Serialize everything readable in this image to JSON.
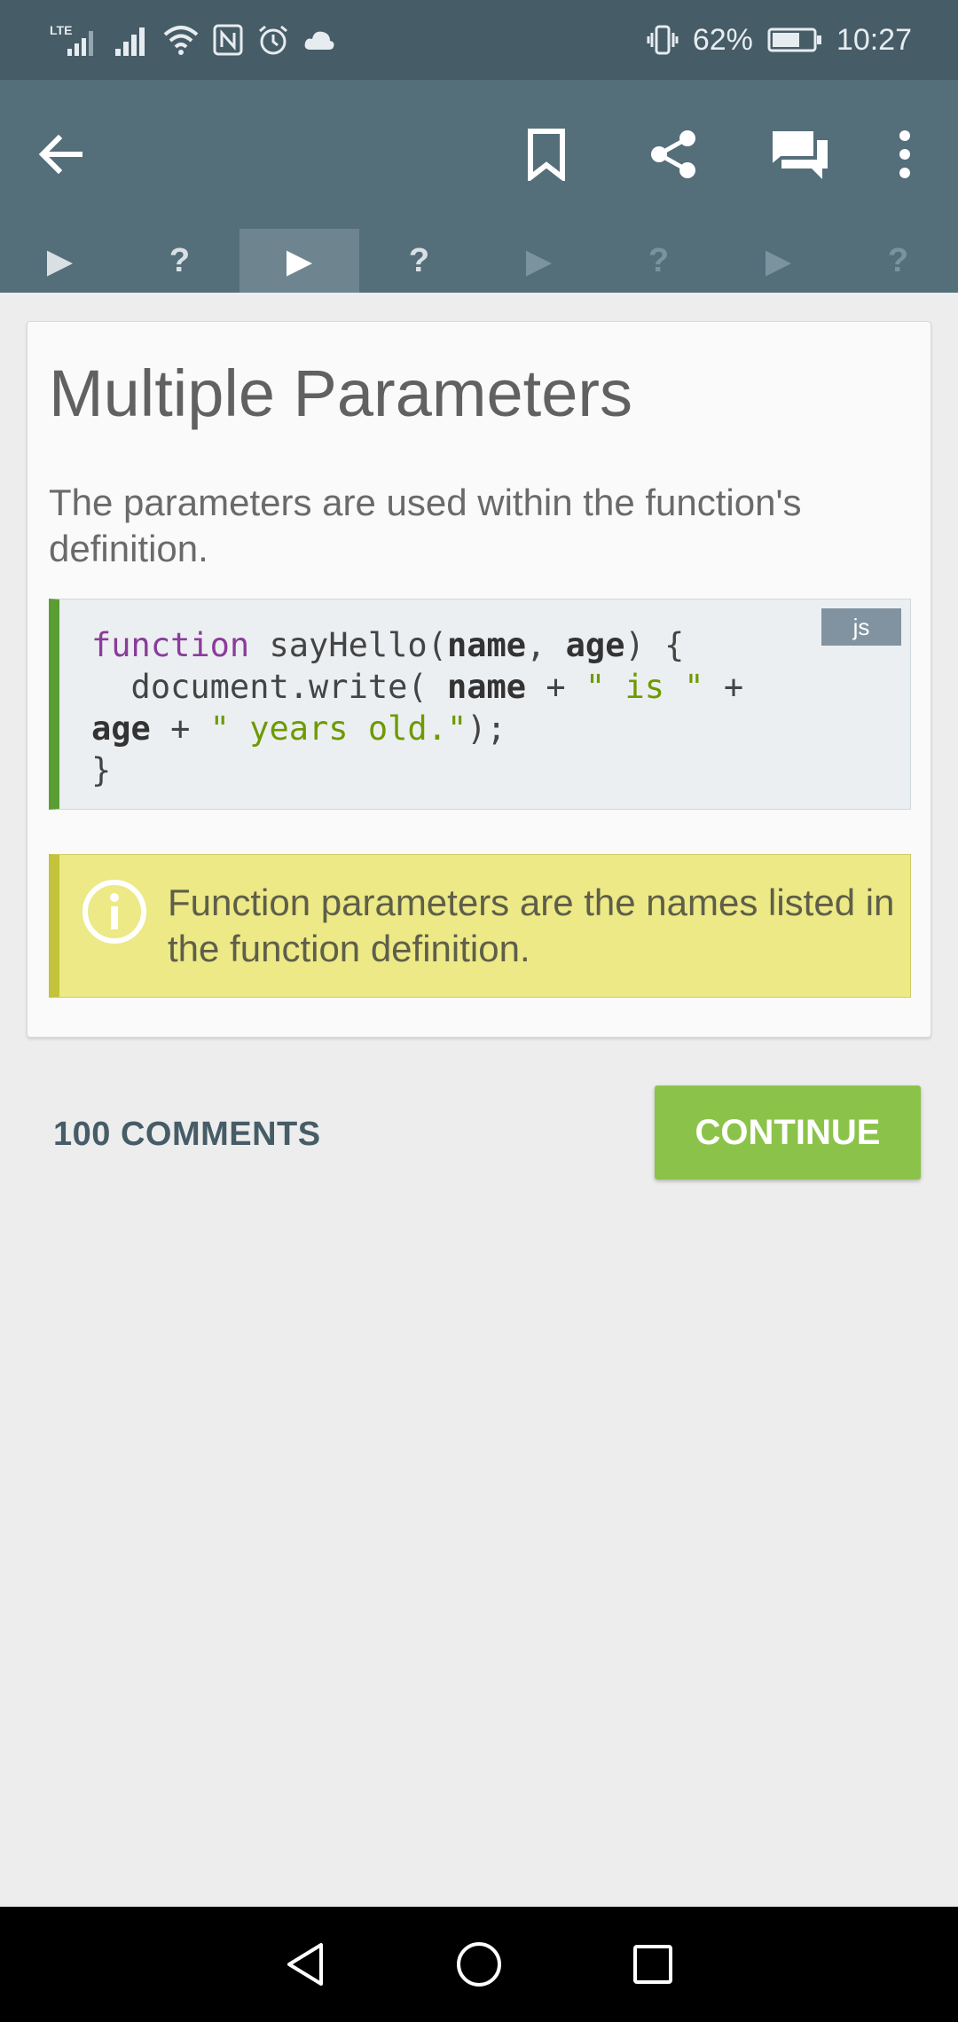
{
  "status_bar": {
    "network_label": "LTE",
    "battery_percent": "62%",
    "time": "10:27",
    "icons": [
      "lte-signal-icon",
      "signal-icon",
      "wifi-icon",
      "nfc-icon",
      "alarm-icon",
      "cloud-icon",
      "vibrate-icon",
      "battery-icon"
    ]
  },
  "toolbar": {
    "icons": [
      "back-arrow-icon",
      "bookmark-icon",
      "share-icon",
      "comments-icon",
      "more-icon"
    ]
  },
  "progress": {
    "steps": [
      {
        "glyph": "▶",
        "type": "lesson",
        "state": "done"
      },
      {
        "glyph": "?",
        "type": "quiz",
        "state": "done"
      },
      {
        "glyph": "▶",
        "type": "lesson",
        "state": "current"
      },
      {
        "glyph": "?",
        "type": "quiz",
        "state": "next"
      },
      {
        "glyph": "▶",
        "type": "lesson",
        "state": "locked"
      },
      {
        "glyph": "?",
        "type": "quiz",
        "state": "locked"
      },
      {
        "glyph": "▶",
        "type": "lesson",
        "state": "locked"
      },
      {
        "glyph": "?",
        "type": "quiz",
        "state": "locked"
      }
    ]
  },
  "lesson": {
    "title": "Multiple Parameters",
    "description": "The parameters are used within the function's definition.",
    "code_lang": "js",
    "code_lines": [
      "function sayHello(name, age) {",
      "  document.write( name + \" is \" +",
      "age + \" years old.\");",
      "}"
    ],
    "note": "Function parameters are the names listed in the function definition."
  },
  "footer": {
    "comments_label": "100 COMMENTS",
    "continue_label": "CONTINUE"
  },
  "colors": {
    "toolbar": "#546e7a",
    "statusbar": "#465c67",
    "accent_green": "#8bc34a",
    "code_border": "#5a9e33",
    "note_bg": "#ece986"
  }
}
